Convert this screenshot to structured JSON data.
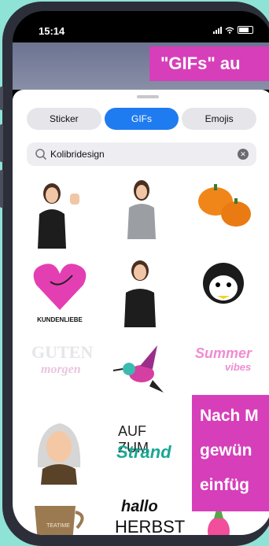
{
  "status": {
    "time": "15:14"
  },
  "overlay_top": {
    "text": "\"GIFs\" au"
  },
  "overlay_bottom": {
    "lines": [
      "Nach M",
      "gewün",
      "einfüg"
    ]
  },
  "tabs": [
    {
      "label": "Sticker",
      "active": false
    },
    {
      "label": "GIFs",
      "active": true
    },
    {
      "label": "Emojis",
      "active": false
    }
  ],
  "search": {
    "value": "Kolibridesign"
  },
  "stickers": {
    "kundenliebe": "KUNDENLIEBE",
    "guten": "GUTEN",
    "morgen": "morgen",
    "summer": "Summer",
    "vibes": "vibes",
    "aufzum": "AUF ZUM",
    "strand": "Strand",
    "hallo": "hallo",
    "herbst": "HERBST",
    "teatime": "TEATIME"
  },
  "colors": {
    "accent_blue": "#1f7bf0",
    "banner_pink": "#d63fb9",
    "background_teal": "#8fe3d6"
  }
}
